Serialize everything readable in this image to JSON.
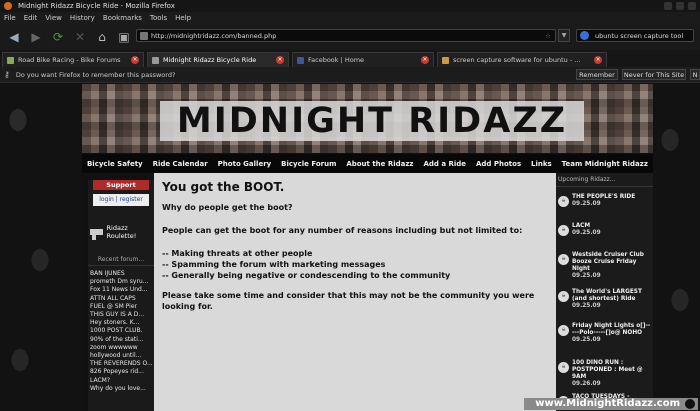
{
  "window": {
    "title": "Midnight Ridazz Bicycle Ride - Mozilla Firefox"
  },
  "menu": [
    "File",
    "Edit",
    "View",
    "History",
    "Bookmarks",
    "Tools",
    "Help"
  ],
  "url": "http://midnightridazz.com/banned.php",
  "search": {
    "value": "ubuntu screen capture tool"
  },
  "tabs": [
    {
      "label": "Road Bike Racing - Bike Forums"
    },
    {
      "label": "Midnight Ridazz Bicycle Ride"
    },
    {
      "label": "Facebook | Home"
    },
    {
      "label": "screen capture software for ubuntu - ..."
    }
  ],
  "notification": {
    "text": "Do you want Firefox to remember this password?",
    "remember": "Remember",
    "never": "Never for This Site"
  },
  "banner": {
    "logo": "MIDNIGHT RIDAZZ"
  },
  "nav": [
    "Bicycle Safety",
    "Ride Calendar",
    "Photo Gallery",
    "Bicycle Forum",
    "About the Ridazz",
    "Add a Ride",
    "Add Photos",
    "Links",
    "Team Midnight Ridazz"
  ],
  "left": {
    "support": "Support",
    "login": "login | register",
    "roulette": "Ridazz Roulette!",
    "recent_header": "Recent forum...",
    "recent": [
      "BAN IJUNES",
      "prometh Dm syru...",
      "Fox 11 News Und...",
      "ATTN ALL CAPS",
      "FUEL @ SM Pier",
      "THIS GUY IS A D...",
      "Hey stoners. K...",
      "1000 POST CLUB.",
      "90% of the stati...",
      "zoom wwwwww",
      "hollywood until...",
      "THE REVERENDS O...",
      "826 Popeyes rid...",
      "LACM?",
      "Why do you love..."
    ]
  },
  "main": {
    "title": "You got the BOOT.",
    "q": "Why do people get the boot?",
    "intro": "People can get the boot for any number of reasons including but not limited to:",
    "reasons": [
      "-- Making threats at other people",
      "-- Spamming the forum with marketing messages",
      "-- Generally being negative or condescending to the community"
    ],
    "closing": "Please take some time and consider that this may not be the community you were looking for."
  },
  "right": {
    "header": "Upcoming Ridazz...",
    "events": [
      {
        "title": "THE PEOPLE'S RIDE",
        "date": "09.25.09"
      },
      {
        "title": "LACM",
        "date": "09.25.09"
      },
      {
        "title": "Westside Cruiser Club Booze Cruise Friday Night",
        "date": "09.25.09"
      },
      {
        "title": "The World's LARGEST (and shortest) Ride",
        "date": "09.25.09"
      },
      {
        "title": "Friday Night Lights o[]-----Polo-----[]o@ NOHO",
        "date": "09.25.09"
      },
      {
        "title": "100 DINO RUN : POSTPONED : Meet @ 9AM",
        "date": "09.26.09"
      },
      {
        "title": "TACO TUESDAYS -",
        "date": ""
      }
    ]
  },
  "watermark": "www.MidnightRidazz.com"
}
